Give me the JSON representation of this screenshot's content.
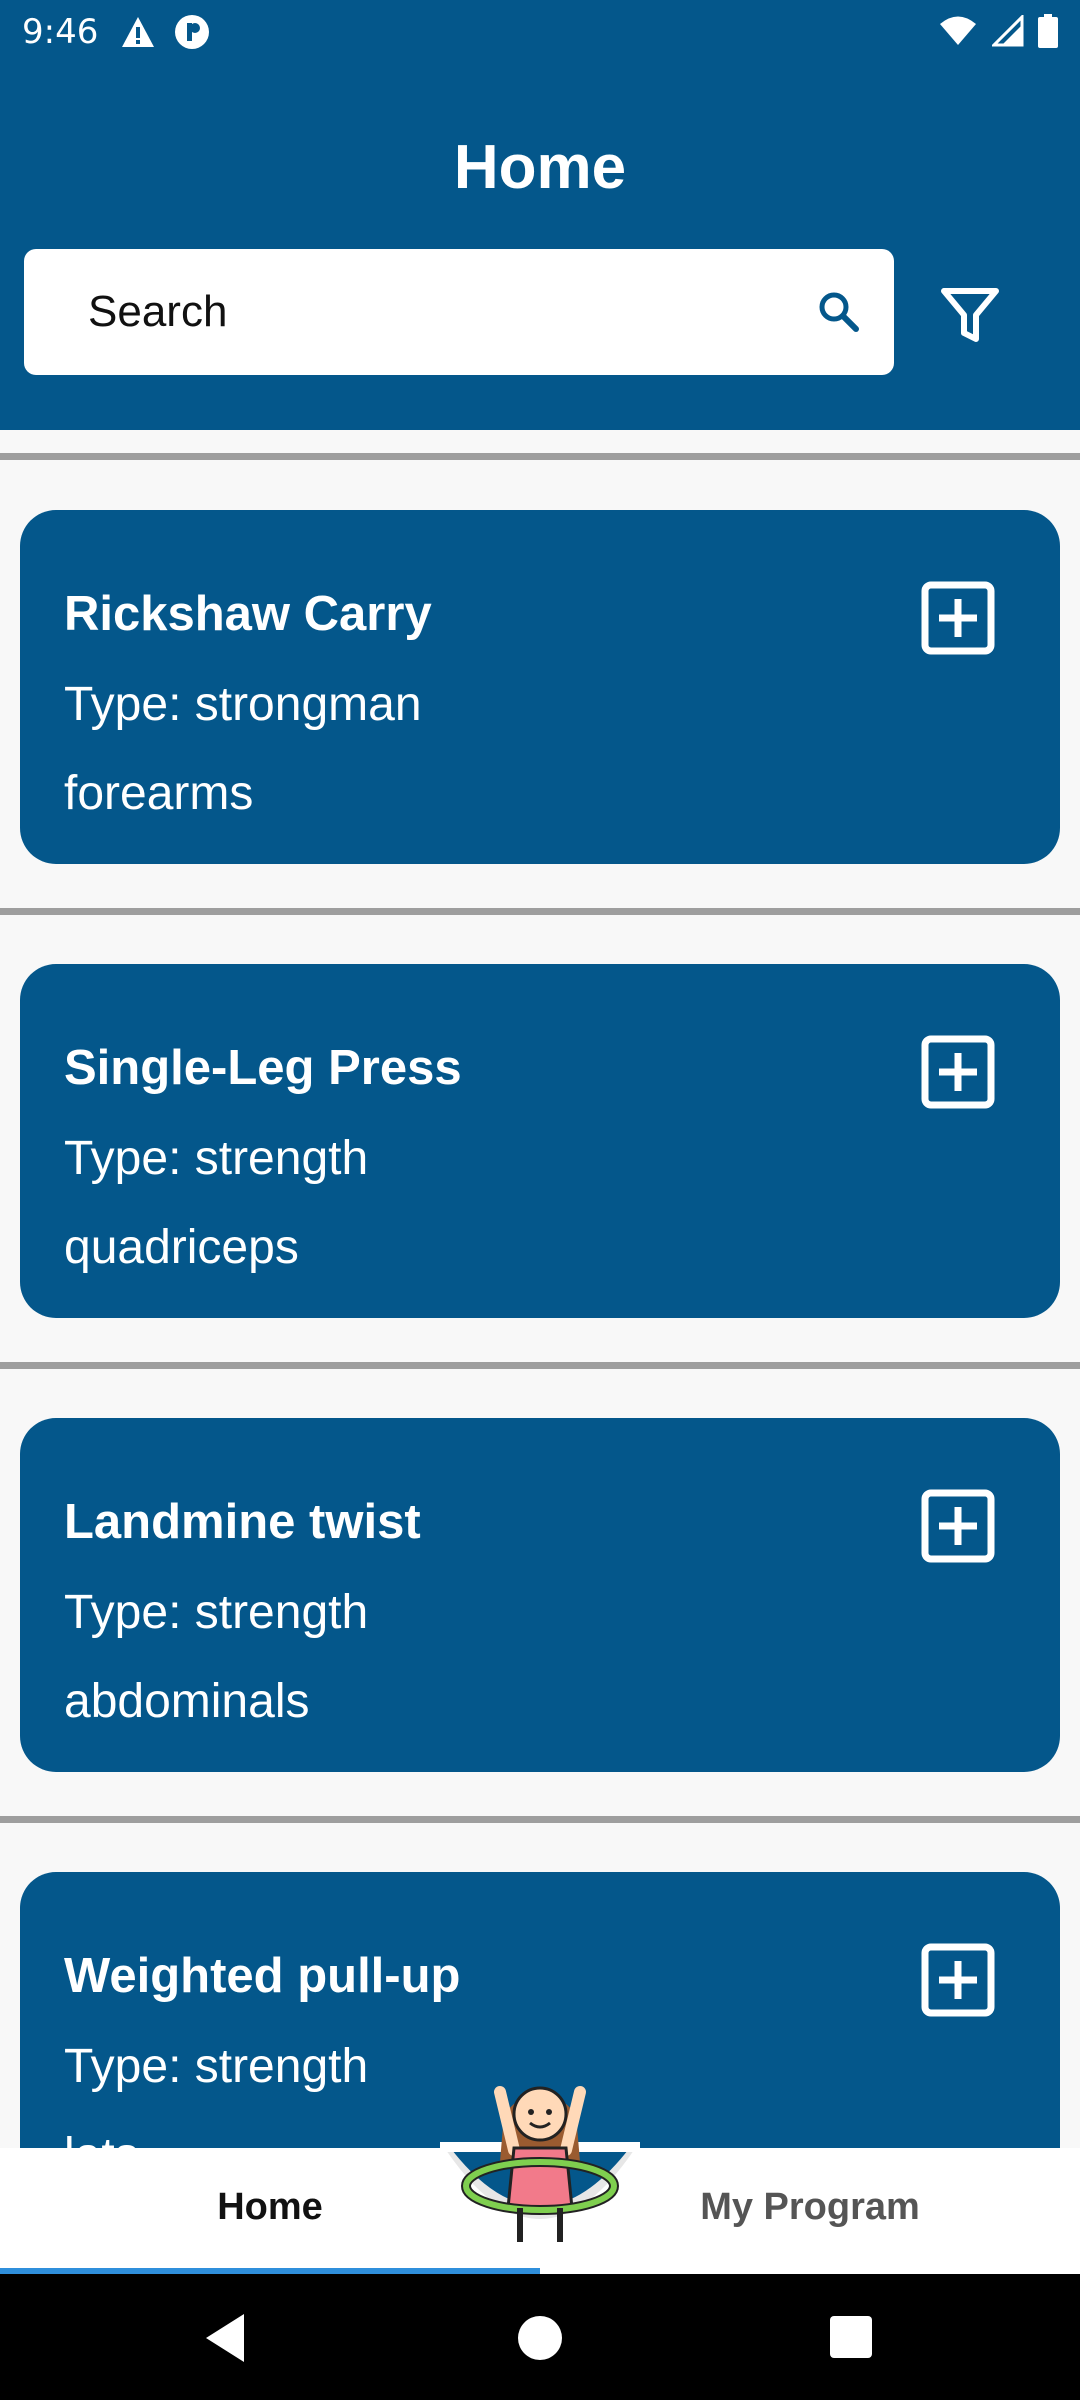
{
  "status_bar": {
    "time": "9:46",
    "left_icons": [
      "warning-icon",
      "data-saver-icon"
    ],
    "right_icons": [
      "wifi-icon",
      "signal-icon",
      "battery-icon"
    ]
  },
  "header": {
    "title": "Home",
    "search_label": "Search"
  },
  "exercises": [
    {
      "name": "Rickshaw Carry",
      "type": "Type: strongman",
      "muscle": "forearms"
    },
    {
      "name": "Single-Leg Press",
      "type": "Type: strength",
      "muscle": "quadriceps"
    },
    {
      "name": "Landmine twist",
      "type": "Type: strength",
      "muscle": "abdominals"
    },
    {
      "name": "Weighted pull-up",
      "type": "Type: strength",
      "muscle": "lats"
    }
  ],
  "bottom_nav": {
    "home_label": "Home",
    "program_label": "My Program",
    "active": "Home"
  },
  "colors": {
    "primary": "#04578b",
    "background": "#f8f8f8",
    "accent": "#2f8fdb",
    "divider": "#9e9e9e"
  }
}
